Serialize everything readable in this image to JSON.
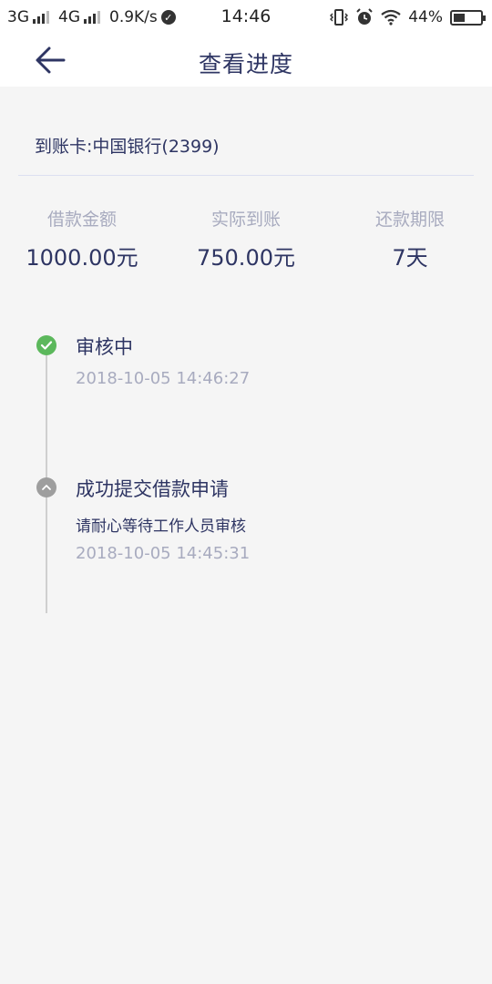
{
  "status_bar": {
    "net1": "3G",
    "net2": "4G",
    "speed": "0.9K/s",
    "time": "14:46",
    "battery": "44%",
    "battery_level": 0.44
  },
  "nav": {
    "title": "查看进度"
  },
  "card": {
    "account": "到账卡:中国银行(2399)"
  },
  "stats": [
    {
      "label": "借款金额",
      "value": "1000.00元"
    },
    {
      "label": "实际到账",
      "value": "750.00元"
    },
    {
      "label": "还款期限",
      "value": "7天"
    }
  ],
  "timeline": [
    {
      "title": "审核中",
      "time": "2018-10-05 14:46:27",
      "status_color": "#5cb85c"
    },
    {
      "title": "成功提交借款申请",
      "desc": "请耐心等待工作人员审核",
      "time": "2018-10-05 14:45:31",
      "status_color": "#9e9e9e"
    }
  ],
  "colors": {
    "primary_text": "#2e3563",
    "muted_text": "#a8abbf",
    "background": "#f5f5f5"
  }
}
